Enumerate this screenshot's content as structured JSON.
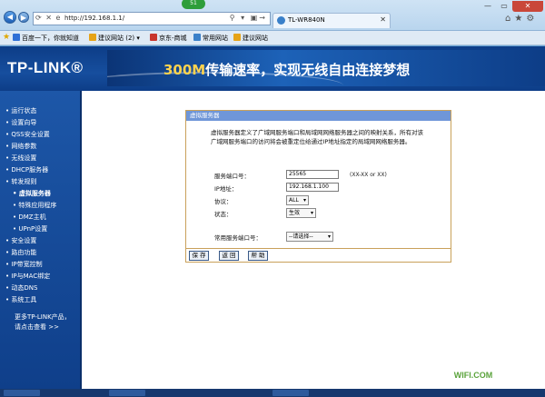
{
  "browser": {
    "badge": "51",
    "url": "http://192.168.1.1/",
    "tab_title": "TL-WR840N",
    "favorites": [
      {
        "label": "百度一下，你就知道"
      },
      {
        "label": "建议网站 (2) ▾"
      },
      {
        "label": "京东-商城"
      },
      {
        "label": "常用网站"
      },
      {
        "label": "建议网站"
      }
    ]
  },
  "header": {
    "logo": "TP-LINK®",
    "banner_highlight": "300M",
    "banner_text": "传输速率，实现无线自由连接梦想"
  },
  "sidebar": {
    "items": [
      {
        "label": "• 运行状态"
      },
      {
        "label": "• 设置向导"
      },
      {
        "label": "• QSS安全设置"
      },
      {
        "label": "• 网络参数"
      },
      {
        "label": "• 无线设置"
      },
      {
        "label": "• DHCP服务器"
      },
      {
        "label": "• 转发规则"
      },
      {
        "label": "• 虚拟服务器"
      },
      {
        "label": "• 特殊应用程序"
      },
      {
        "label": "• DMZ主机"
      },
      {
        "label": "• UPnP设置"
      },
      {
        "label": "• 安全设置"
      },
      {
        "label": "• 路由功能"
      },
      {
        "label": "• IP带宽控制"
      },
      {
        "label": "• IP与MAC绑定"
      },
      {
        "label": "• 动态DNS"
      },
      {
        "label": "• 系统工具"
      }
    ],
    "more_line1": "更多TP-LINK产品，",
    "more_line2": "请点击查看 >>"
  },
  "panel": {
    "title": "虚拟服务器",
    "description": "虚拟服务器定义了广域网服务端口和局域网网络服务器之间的映射关系，所有对该广域网服务端口的访问将会被重定位给通过IP地址指定的局域网网络服务器。",
    "service_port_label": "服务端口号：",
    "service_port_value": "25565",
    "service_port_hint": "(XX-XX or XX)",
    "ip_label": "IP地址：",
    "ip_value": "192.168.1.100",
    "protocol_label": "协议：",
    "protocol_value": "ALL",
    "status_label": "状态：",
    "status_value": "生效",
    "common_port_label": "常用服务端口号：",
    "common_port_value": "--请选择--",
    "save_label": "保 存",
    "back_label": "返 回",
    "help_label": "帮 助"
  },
  "watermark": "WIFI.COM"
}
